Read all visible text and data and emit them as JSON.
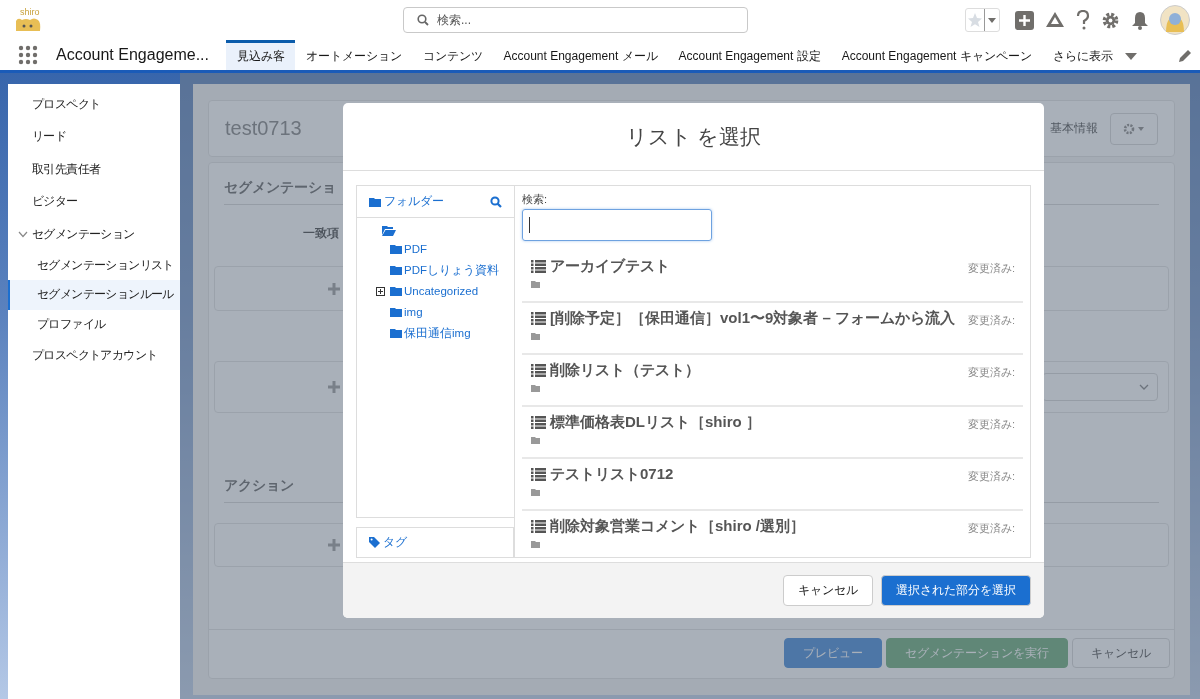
{
  "top_bar": {
    "logo_text": "shiro",
    "search": {
      "placeholder": "検索..."
    }
  },
  "nav": {
    "app_name": "Account Engageme...",
    "tabs": [
      {
        "label": "見込み客",
        "selected": true
      },
      {
        "label": "オートメーション",
        "selected": false
      },
      {
        "label": "コンテンツ",
        "selected": false
      },
      {
        "label": "Account Engagement メール",
        "selected": false
      },
      {
        "label": "Account Engagement 設定",
        "selected": false
      },
      {
        "label": "Account Engagement キャンペーン",
        "selected": false
      }
    ],
    "more": "さらに表示"
  },
  "sidebar": {
    "items": [
      {
        "label": "プロスペクト",
        "selected": false
      },
      {
        "label": "リード",
        "selected": false
      },
      {
        "label": "取引先責任者",
        "selected": false
      },
      {
        "label": "ビジター",
        "selected": false
      },
      {
        "label": "セグメンテーション",
        "selected": false,
        "expanded": true,
        "children": [
          {
            "label": "セグメンテーションリスト",
            "selected": false
          },
          {
            "label": "セグメンテーションルール",
            "selected": true
          },
          {
            "label": "プロファイル",
            "selected": false
          }
        ]
      },
      {
        "label": "プロスペクトアカウント",
        "selected": false
      }
    ]
  },
  "record": {
    "title": "test0713",
    "info_button": "基本情報"
  },
  "segmentation": {
    "heading": "セグメンテーショ",
    "match_label": "一致項",
    "action_heading": "アクション",
    "footer_buttons": [
      {
        "label": "プレビュー",
        "kind": "primary"
      },
      {
        "label": "セグメンテーションを実行",
        "kind": "success"
      },
      {
        "label": "キャンセル",
        "kind": "neutral"
      }
    ]
  },
  "modal": {
    "title": "リスト を選択",
    "folders": {
      "label": "フォルダー",
      "tree": [
        {
          "expanded": true,
          "children": [
            {
              "label": "PDF"
            },
            {
              "label": "PDFしりょう資料"
            },
            {
              "label": "Uncategorized",
              "expanded": false
            },
            {
              "label": "img"
            },
            {
              "label": "保田通信img"
            }
          ]
        }
      ]
    },
    "tags": {
      "label": "タグ"
    },
    "search": {
      "label": "検索:"
    },
    "lists": [
      {
        "name": "アーカイブテスト",
        "modified": "変更済み:"
      },
      {
        "name": "[削除予定］［保田通信］vol1〜9対象者 – フォームから流入",
        "modified": "変更済み:"
      },
      {
        "name": "削除リスト（テスト）",
        "modified": "変更済み:"
      },
      {
        "name": "標準価格表DLリスト［shiro ］",
        "modified": "変更済み:"
      },
      {
        "name": "テストリスト0712",
        "modified": "変更済み:"
      },
      {
        "name": "削除対象営業コメント［shiro /選別］",
        "modified": "変更済み:"
      }
    ],
    "buttons": [
      {
        "label": "キャンセル",
        "kind": "neutral"
      },
      {
        "label": "選択された部分を選択",
        "kind": "brand"
      }
    ]
  }
}
